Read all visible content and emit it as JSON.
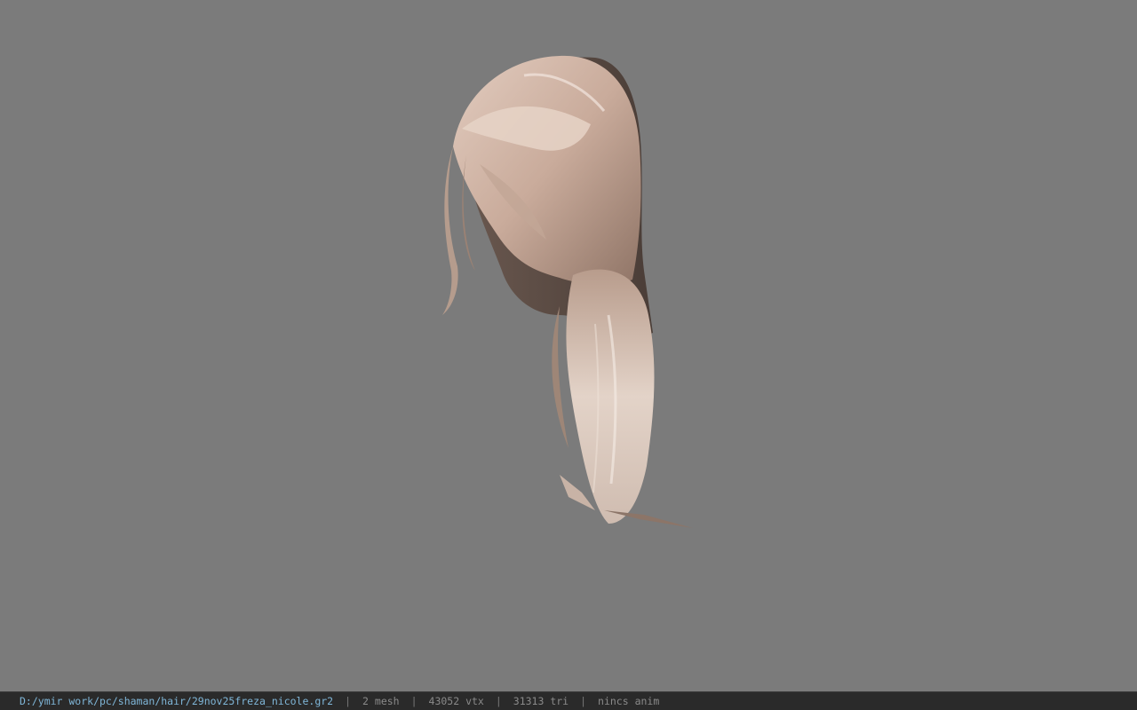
{
  "viewport": {
    "background_color": "#7b7b7b",
    "model": {
      "icon": "hair-mesh-render",
      "hair_colors": [
        "#d8c2b4",
        "#a98d7e",
        "#5f4f47"
      ]
    }
  },
  "status_bar": {
    "file_path": "D:/ymir work/pc/shaman/hair/29nov25freza_nicole.gr2",
    "separator": "|",
    "mesh": "2 mesh",
    "vertices": "43052 vtx",
    "triangles": "31313 tri",
    "anim": "nincs anim"
  }
}
